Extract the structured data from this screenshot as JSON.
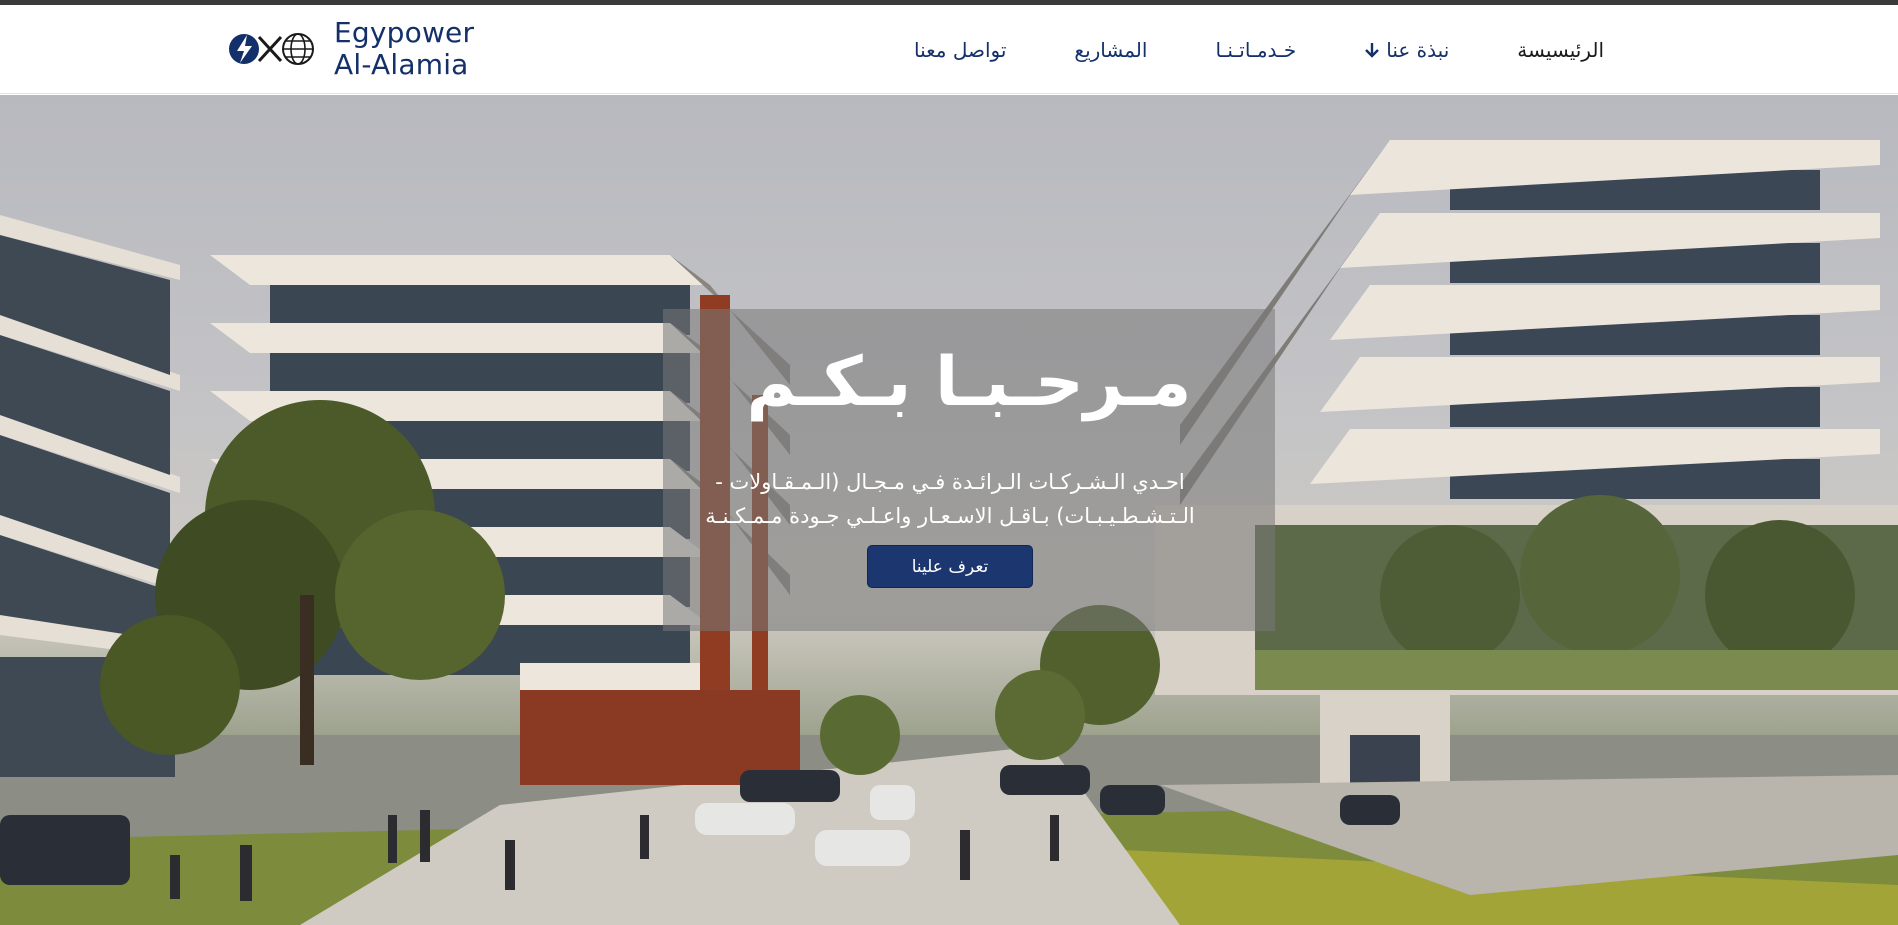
{
  "brand": {
    "line1": "Egypower",
    "line2": "Al-Alamia",
    "logo_icon": "lightning-globe-logo"
  },
  "nav": {
    "items": [
      {
        "label": "الرئيسيسة"
      },
      {
        "label": "نبذة عنا",
        "icon": "arrow-down-icon"
      },
      {
        "label": "خـدمـاتـنـا"
      },
      {
        "label": "المشاريع"
      },
      {
        "label": "تواصل معنا"
      }
    ]
  },
  "hero": {
    "title": "مـرحـبـا بـكـم",
    "subtitle": "احـدي الـشـركـات الـرائـدة فـي مـجـال (الـمـقـاولات - الـتـشـطـيـبـات) بـاقـل الاسـعـار واعـلـي جـودة مـمـكـنـة",
    "button_label": "تعرف علينا"
  },
  "colors": {
    "brand_navy": "#14306a",
    "button_bg": "#1c3770",
    "overlay": "rgba(120,120,120,0.55)"
  }
}
